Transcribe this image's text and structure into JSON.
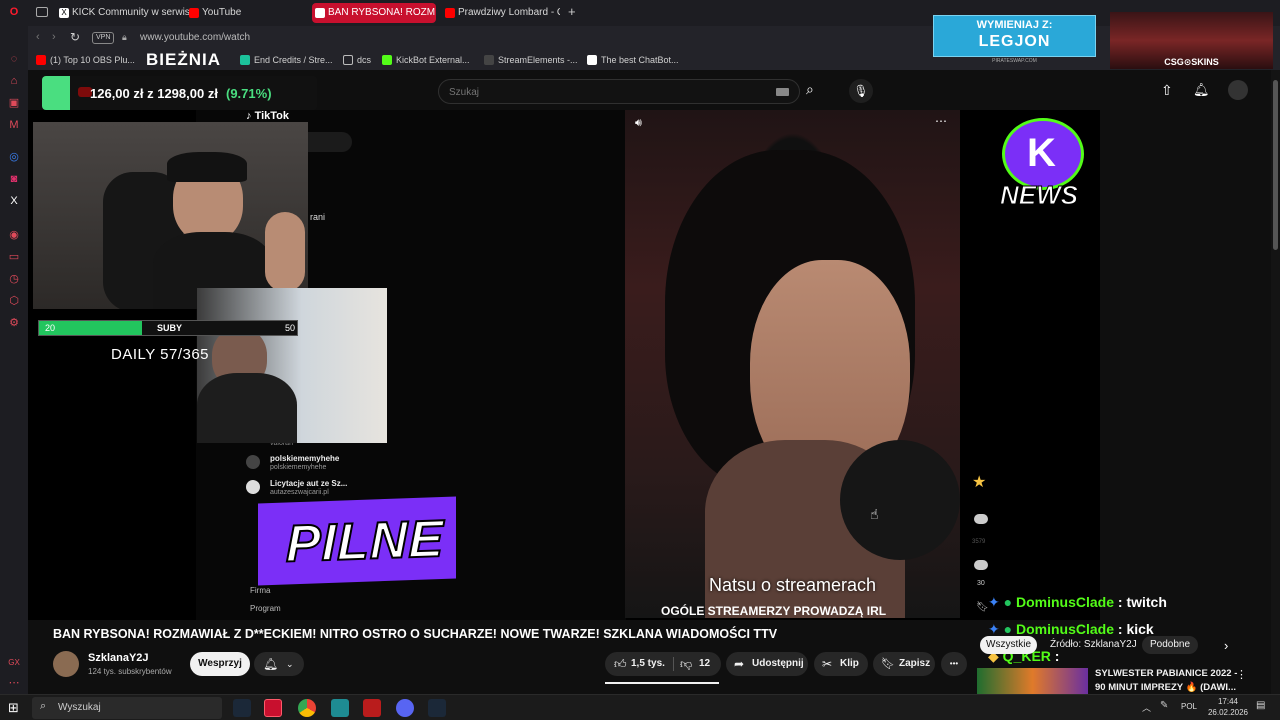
{
  "browser": {
    "tabs": [
      {
        "label": "KICK Community w serwis"
      },
      {
        "label": "YouTube"
      },
      {
        "label": "BAN RYBSONA! ROZM"
      },
      {
        "label": "Prawdziwy Lombard - Odc"
      }
    ],
    "new_tab": "+",
    "url": "www.youtube.com/watch",
    "vpn_label": "VPN",
    "bookmarks": [
      {
        "label": "(1) Top 10 OBS Plu..."
      },
      {
        "label": "End Credits / Stre..."
      },
      {
        "label": "dcs"
      },
      {
        "label": "KickBot External..."
      },
      {
        "label": "StreamElements -..."
      },
      {
        "label": "The best ChatBot..."
      }
    ]
  },
  "youtube": {
    "search_placeholder": "Szukaj",
    "video_title": "BAN RYBSONA! ROZMAWIAŁ Z D**ECKIEM! NITRO OSTRO O SUCHARZE! NOWE TWARZE! SZKLANA WIADOMOŚCI TTV",
    "channel_name": "SzklanaY2J",
    "subscribers": "124 tys. subskrybentów",
    "support_label": "Wesprzyj",
    "likes": "1,5 tys.",
    "dislikes": "12",
    "share_label": "Udostępnij",
    "clip_label": "Klip",
    "save_label": "Zapisz",
    "more_label": "•••",
    "chips": {
      "all": "Wszystkie",
      "source": "Źródło: SzklanaY2J",
      "similar": "Podobne"
    },
    "rec_title_1": "SYLWESTER PABIANICE 2022 -",
    "rec_title_2": "90 MINUT IMPREZY 🔥 (DAWI..."
  },
  "stream_overlay": {
    "bieznia_label": "BIEŻNIA",
    "progress_text": "126,00 zł z 1298,00 zł",
    "progress_percent": "(9.71%)",
    "progress_fraction": 0.0971,
    "subs_bar": {
      "left": "20",
      "label": "SUBY",
      "right": "50",
      "fill_fraction": 0.4
    },
    "daily_text": "DAILY 57/365",
    "tiktok_label": "TikTok",
    "pilne_label": "PILNE",
    "news_label": "NEWS",
    "ad_top": "WYMIENIAJ Z:",
    "ad_main": "LEGJON",
    "ad_small": "PIRATESWAP.COM",
    "csg_label": "CSG⊙SKINS",
    "video_caption": "Natsu o streamerach",
    "video_subcaption": "OGÓLE STREAMERZY PROWADZĄ IRL",
    "like_count_side": "3579",
    "comment_count_side": "30",
    "chat": [
      {
        "user": "DominusClade",
        "message": ": twitch"
      },
      {
        "user": "DominusClade",
        "message": ": kick"
      },
      {
        "user": "Q_KER",
        "message": ":"
      }
    ],
    "tiktok_items": [
      {
        "name": "polskiememyhehe",
        "handle": "polskiememyhehe"
      },
      {
        "name": "Licytacje aut ze Sz...",
        "handle": "autazeszwajcarii.pl"
      }
    ],
    "tiktok_bottom": [
      "Firma",
      "Program"
    ],
    "tiktok_misc": [
      "rani",
      "valoran"
    ]
  },
  "taskbar": {
    "search_placeholder": "Wyszukaj",
    "lang": "POL",
    "time": "17:44",
    "date": "26.02.2026"
  },
  "colors": {
    "tab_active": "#c8102e",
    "youtube_red": "#ff0000",
    "subs_green": "#22c55e",
    "pilne_purple": "#7b2ff7",
    "chat_green": "#53fc18",
    "progress_green": "#4ade80"
  }
}
